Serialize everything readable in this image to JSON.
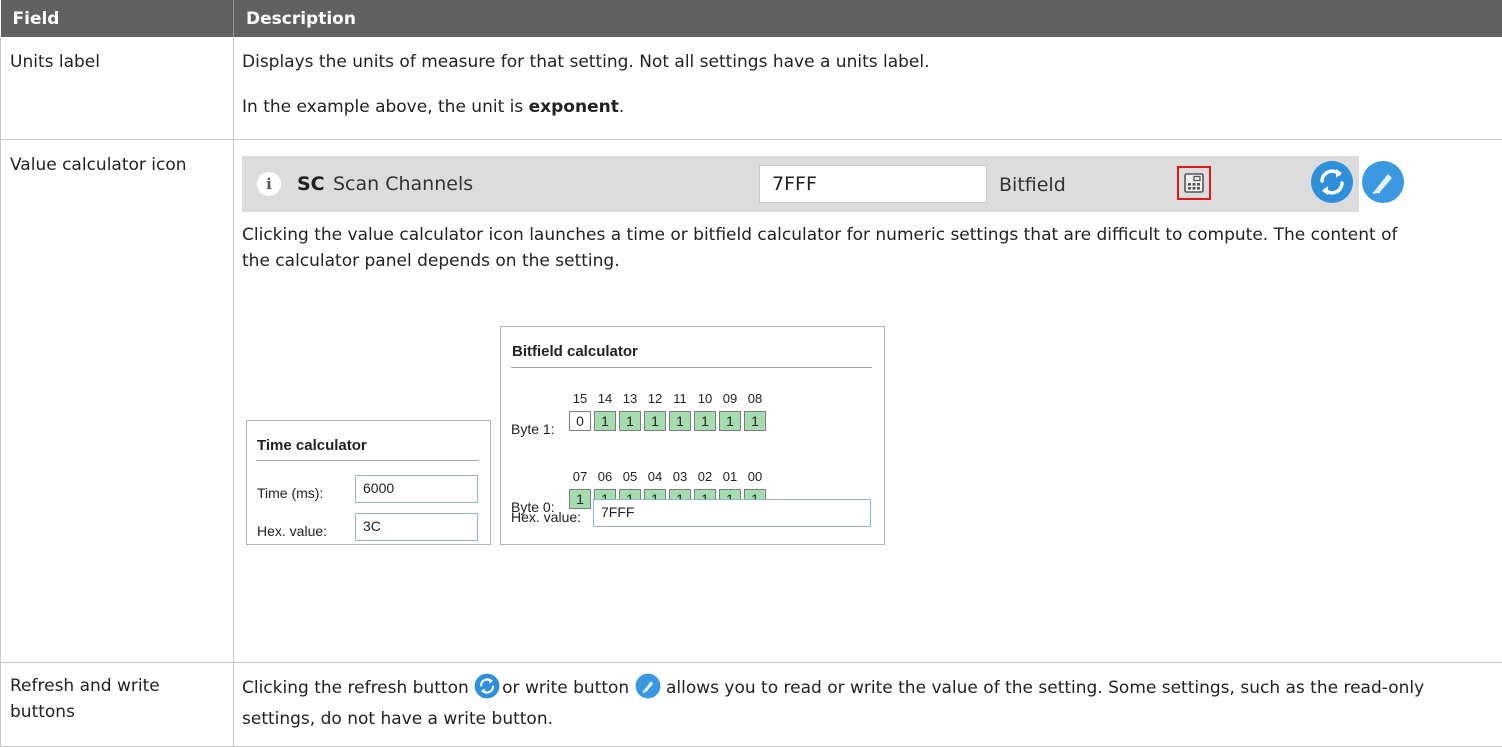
{
  "table": {
    "headers": {
      "field": "Field",
      "description": "Description"
    },
    "rows": [
      {
        "field": "Units label",
        "desc_p1": "Displays the units of measure for that setting. Not all settings have a units label.",
        "desc_p2_prefix": "In the example above, the unit is ",
        "desc_p2_bold": "exponent",
        "desc_p2_suffix": "."
      },
      {
        "field": "Value calculator icon",
        "setting": {
          "code": "SC",
          "name": "Scan Channels",
          "value": "7FFF",
          "units": "Bitfield"
        },
        "desc": "Clicking the value calculator icon launches a time or bitfield calculator for numeric settings that are difficult to compute. The content of the calculator panel depends on the setting.",
        "time_calculator": {
          "title": "Time calculator",
          "time_label": "Time (ms):",
          "time_value": "6000",
          "hex_label": "Hex. value:",
          "hex_value": "3C"
        },
        "bitfield_calculator": {
          "title": "Bitfield calculator",
          "byte1_label": "Byte 1:",
          "byte1_bit_numbers": [
            "15",
            "14",
            "13",
            "12",
            "11",
            "10",
            "09",
            "08"
          ],
          "byte1_bits": [
            "0",
            "1",
            "1",
            "1",
            "1",
            "1",
            "1",
            "1"
          ],
          "byte0_label": "Byte 0:",
          "byte0_bit_numbers": [
            "07",
            "06",
            "05",
            "04",
            "03",
            "02",
            "01",
            "00"
          ],
          "byte0_bits": [
            "1",
            "1",
            "1",
            "1",
            "1",
            "1",
            "1",
            "1"
          ],
          "hex_label": "Hex. value:",
          "hex_value": "7FFF"
        }
      },
      {
        "field": "Refresh and write buttons",
        "desc_part1": "Clicking the refresh button ",
        "desc_part2": "or write button ",
        "desc_part3": " allows you to read or write the value of the setting. Some settings, such as the read-only settings, do not have a write button."
      }
    ]
  },
  "colors": {
    "header_bg": "#616161",
    "icon_blue": "#2f8fd8",
    "bit_on": "#a6ddb0",
    "highlight_red": "#e01818"
  },
  "icons": [
    "info-icon",
    "calculator-icon",
    "refresh-icon",
    "write-icon"
  ]
}
